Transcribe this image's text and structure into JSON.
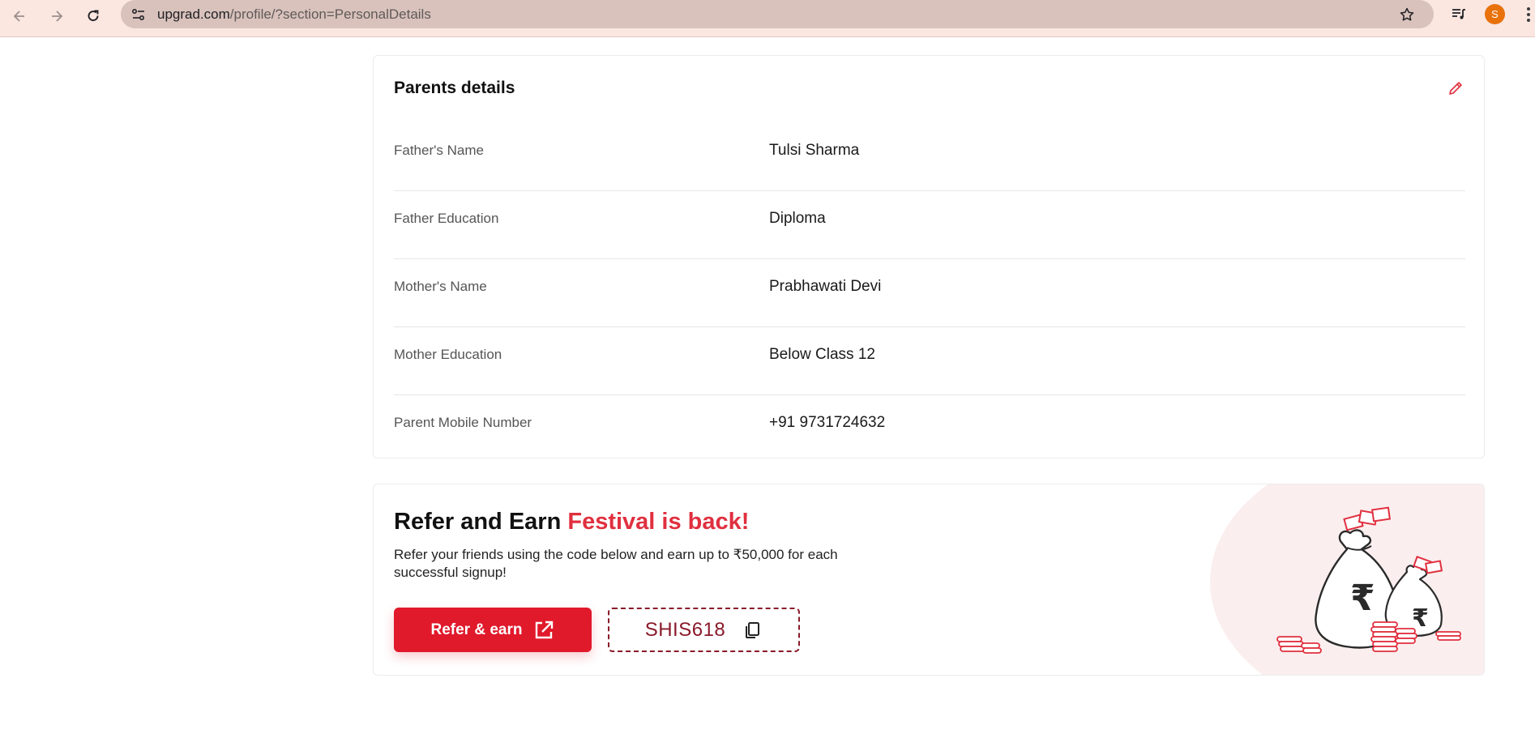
{
  "browser": {
    "url_domain": "upgrad.com",
    "url_path": "/profile/?section=PersonalDetails",
    "icons": [
      "back-icon",
      "forward-icon",
      "reload-icon",
      "site-info-icon",
      "star-icon",
      "media-icon",
      "kebab-menu-icon"
    ],
    "avatar_letter": "S",
    "avatar_color": "#e8710a"
  },
  "parents": {
    "title": "Parents details",
    "rows": [
      {
        "label": "Father's Name",
        "value": "Tulsi Sharma"
      },
      {
        "label": "Father Education",
        "value": "Diploma"
      },
      {
        "label": "Mother's Name",
        "value": "Prabhawati Devi"
      },
      {
        "label": "Mother Education",
        "value": "Below Class 12"
      },
      {
        "label": "Parent Mobile Number",
        "value": "+91 9731724632"
      }
    ]
  },
  "refer": {
    "title": "Refer and Earn",
    "title_accent": "Festival is back!",
    "description": "Refer your friends using the code below and earn up to ₹50,000 for each successful signup!",
    "button_label": "Refer & earn",
    "code": "SHIS618",
    "accent_color": "#e0303f",
    "button_color": "#e0192b"
  }
}
